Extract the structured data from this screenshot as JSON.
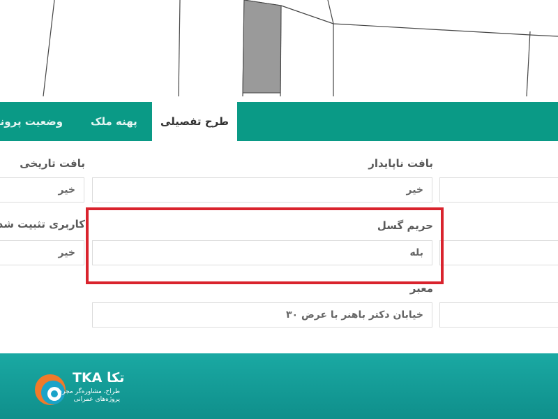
{
  "tabs": [
    {
      "label": "طرح تفصیلی",
      "active": true
    },
    {
      "label": "پهنه ملک",
      "active": false
    },
    {
      "label": "وضعیت پروند",
      "active": false
    }
  ],
  "fields": {
    "unstable_fabric": {
      "label": "بافت ناپایدار",
      "value": "خیر"
    },
    "historic_fabric": {
      "label": "بافت تاریخی",
      "value": "خیر"
    },
    "fault_zone": {
      "label": "حریم گسل",
      "value": "بله"
    },
    "fixed_usage": {
      "label": "کاربری تثبیت شد",
      "value": "خیر"
    },
    "passage": {
      "label": "معبر",
      "value": "خیابان دکتر باهنر با عرض ۳۰"
    }
  },
  "footer": {
    "brand_latin": "TKA",
    "brand_persian": "تکا",
    "tagline_1": "طراح، مشاوره‌گر مجری",
    "tagline_2": "پروژه‌های عمرانی"
  },
  "colors": {
    "accent": "#0a9a86",
    "highlight": "#d9232d",
    "footer": "#15a09b"
  }
}
